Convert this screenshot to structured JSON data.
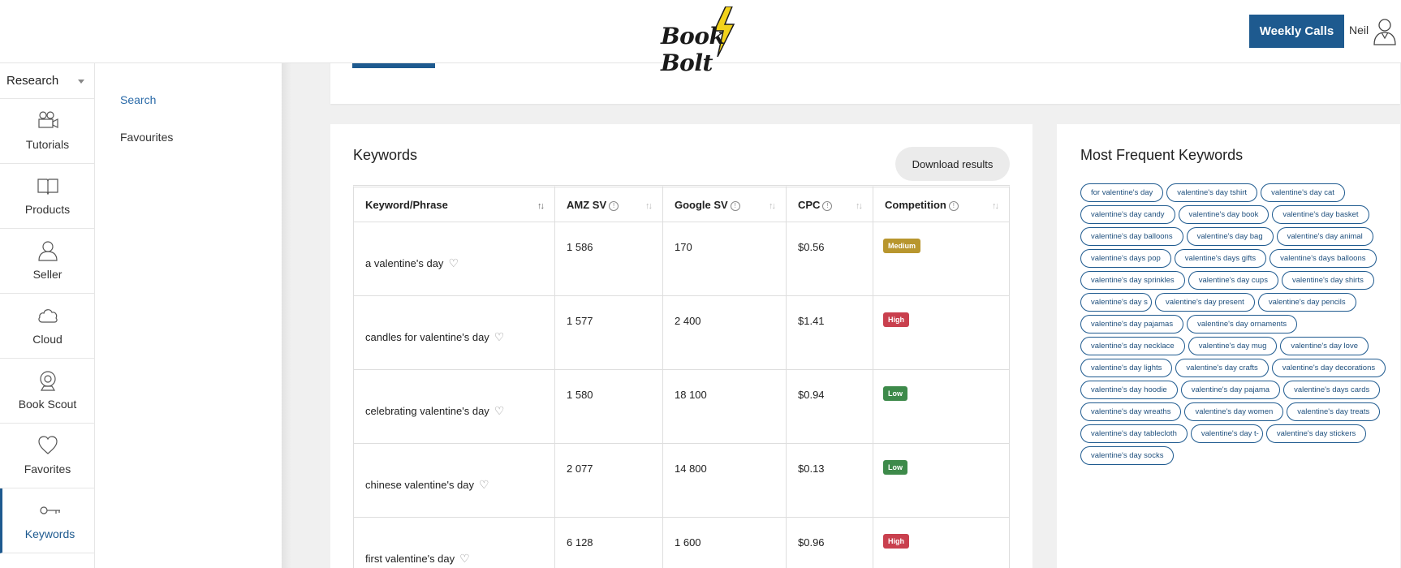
{
  "header": {
    "logo_text": "Book Bolt",
    "weekly_button": "Weekly Calls",
    "user_name": "Neil"
  },
  "sidebar": {
    "module": "Research",
    "items": [
      {
        "label": "Tutorials",
        "icon": "film-camera-icon"
      },
      {
        "label": "Products",
        "icon": "book-icon"
      },
      {
        "label": "Seller",
        "icon": "seller-icon"
      },
      {
        "label": "Cloud",
        "icon": "cloud-icon"
      },
      {
        "label": "Book Scout",
        "icon": "webcam-icon"
      },
      {
        "label": "Favorites",
        "icon": "heart-icon"
      },
      {
        "label": "Keywords",
        "icon": "key-icon",
        "active": true
      }
    ]
  },
  "subnav": {
    "items": [
      {
        "label": "Search",
        "active": true
      },
      {
        "label": "Favourites"
      }
    ]
  },
  "keywords": {
    "title": "Keywords",
    "download_button": "Download results",
    "columns": [
      "Keyword/Phrase",
      "AMZ SV",
      "Google SV",
      "CPC",
      "Competition"
    ],
    "rows": [
      {
        "phrase": "a valentine's day",
        "amz_sv": "1 586",
        "google_sv": "170",
        "cpc": "$0.56",
        "competition": "Medium"
      },
      {
        "phrase": "candles for valentine's day",
        "amz_sv": "1 577",
        "google_sv": "2 400",
        "cpc": "$1.41",
        "competition": "High"
      },
      {
        "phrase": "celebrating valentine's day",
        "amz_sv": "1 580",
        "google_sv": "18 100",
        "cpc": "$0.94",
        "competition": "Low"
      },
      {
        "phrase": "chinese valentine's day",
        "amz_sv": "2 077",
        "google_sv": "14 800",
        "cpc": "$0.13",
        "competition": "Low"
      },
      {
        "phrase": "first valentine's day",
        "amz_sv": "6 128",
        "google_sv": "1 600",
        "cpc": "$0.96",
        "competition": "High"
      }
    ],
    "competition_colors": {
      "Medium": "#b8962e",
      "High": "#c9404e",
      "Low": "#3d8a4a"
    }
  },
  "frequent": {
    "title": "Most Frequent Keywords",
    "chips": [
      "for valentine's day",
      "valentine's day tshirt",
      "valentine's day cat",
      "valentine's day candy",
      "valentine's day book",
      "valentine's day basket",
      "valentine's day balloons",
      "valentine's day bag",
      "valentine's day animal",
      "valentine's days pop",
      "valentine's days gifts",
      "valentine's days balloons",
      "valentine's day sprinkles",
      "valentine's day cups",
      "valentine's day shirts",
      "valentine's day s",
      "valentine's day present",
      "valentine's day pencils",
      "valentine's day pajamas",
      "valentine's day ornaments",
      "valentine's day necklace",
      "valentine's day mug",
      "valentine's day love",
      "valentine's day lights",
      "valentine's day crafts",
      "valentine's day decorations",
      "valentine's day hoodie",
      "valentine's day pajama",
      "valentine's days cards",
      "valentine's day wreaths",
      "valentine's day women",
      "valentine's day treats",
      "valentine's day tablecloth",
      "valentine's day t-",
      "valentine's day stickers",
      "valentine's day socks"
    ]
  }
}
